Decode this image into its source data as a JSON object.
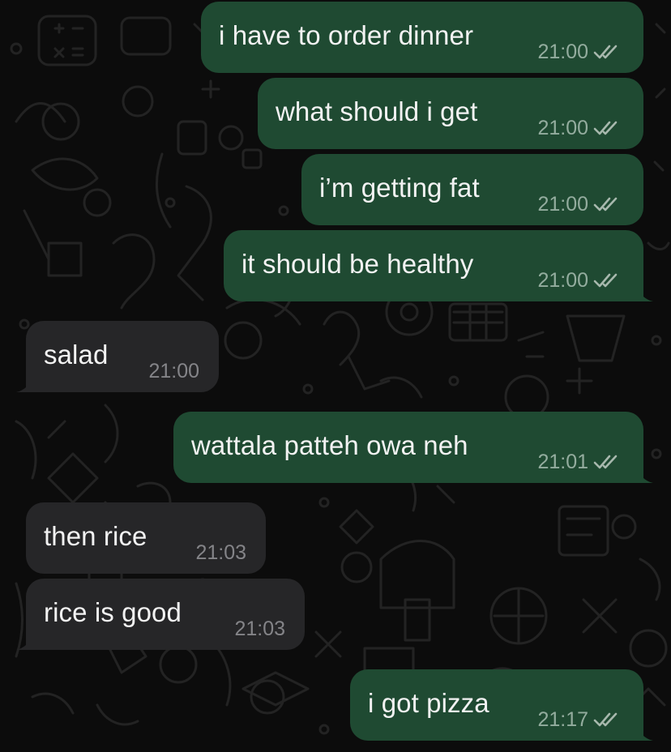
{
  "messages": [
    {
      "direction": "out",
      "text": "i have to order dinner",
      "time": "21:00",
      "status_icon": "read-double-check-icon"
    },
    {
      "direction": "out",
      "text": "what should i get",
      "time": "21:00",
      "status_icon": "read-double-check-icon"
    },
    {
      "direction": "out",
      "text": "i’m getting fat",
      "time": "21:00",
      "status_icon": "read-double-check-icon"
    },
    {
      "direction": "out",
      "text": "it should be healthy",
      "time": "21:00",
      "status_icon": "read-double-check-icon"
    },
    {
      "direction": "in",
      "text": "salad",
      "time": "21:00"
    },
    {
      "direction": "out",
      "text": "wattala patteh owa neh",
      "time": "21:01",
      "status_icon": "read-double-check-icon"
    },
    {
      "direction": "in",
      "text": "then rice",
      "time": "21:03"
    },
    {
      "direction": "in",
      "text": "rice is good",
      "time": "21:03"
    },
    {
      "direction": "out",
      "text": "i got pizza",
      "time": "21:17",
      "status_icon": "read-double-check-icon"
    }
  ],
  "colors": {
    "background": "#0c0c0c",
    "outgoing_bubble": "#1f4a32",
    "incoming_bubble": "#262628",
    "message_text": "#f2f2f2",
    "wallpaper_doodle": "#242424"
  }
}
